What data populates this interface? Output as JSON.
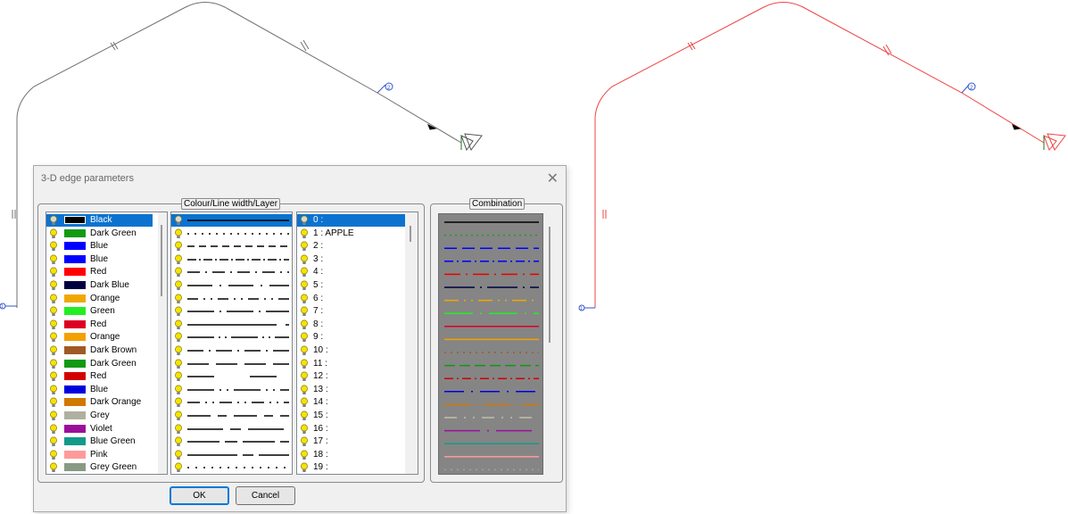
{
  "dialog": {
    "title": "3-D edge parameters",
    "group_colour_label": "Colour/Line width/Layer",
    "group_combination_label": "Combination",
    "ok_label": "OK",
    "cancel_label": "Cancel"
  },
  "colours": [
    {
      "name": "Black",
      "color": "#000000",
      "selected": true
    },
    {
      "name": "Dark Green",
      "color": "#129a12"
    },
    {
      "name": "Blue",
      "color": "#0000ff"
    },
    {
      "name": "Blue",
      "color": "#0000ff"
    },
    {
      "name": "Red",
      "color": "#ff0000"
    },
    {
      "name": "Dark Blue",
      "color": "#000040"
    },
    {
      "name": "Orange",
      "color": "#f0a800"
    },
    {
      "name": "Green",
      "color": "#22ee22"
    },
    {
      "name": "Red",
      "color": "#dd0022"
    },
    {
      "name": "Orange",
      "color": "#f4a000"
    },
    {
      "name": "Dark Brown",
      "color": "#a05a24"
    },
    {
      "name": "Dark Green",
      "color": "#119911"
    },
    {
      "name": "Red",
      "color": "#d40000"
    },
    {
      "name": "Blue",
      "color": "#0000dd"
    },
    {
      "name": "Dark Orange",
      "color": "#d07800"
    },
    {
      "name": "Grey",
      "color": "#b0b0a0"
    },
    {
      "name": "Violet",
      "color": "#9a0f9a"
    },
    {
      "name": "Blue Green",
      "color": "#129a88"
    },
    {
      "name": "Pink",
      "color": "#ff9a9a"
    },
    {
      "name": "Grey Green",
      "color": "#889a84"
    }
  ],
  "linestyles": [
    {
      "dash": "",
      "selected": true
    },
    {
      "dash": "2 6"
    },
    {
      "dash": "8 5"
    },
    {
      "dash": "10 3 2 3"
    },
    {
      "dash": "14 6 2 6"
    },
    {
      "dash": "28 8 2 8"
    },
    {
      "dash": "12 6 2 6 2 6"
    },
    {
      "dash": "30 6 2 6"
    },
    {
      "dash": "100 10"
    },
    {
      "dash": "30 5 2 5 2 5"
    },
    {
      "dash": "18 6 2 6"
    },
    {
      "dash": "24 8"
    },
    {
      "dash": "30 40"
    },
    {
      "dash": "30 6 2 6 2 6"
    },
    {
      "dash": "14 6 2 6 2 6"
    },
    {
      "dash": "26 8 10 8"
    },
    {
      "dash": "40 8 12 8"
    },
    {
      "dash": "36 6 14 6"
    },
    {
      "dash": "56 6 12 6"
    },
    {
      "dash": "2 7"
    }
  ],
  "layers": [
    {
      "label": "0 :",
      "selected": true
    },
    {
      "label": "1 : APPLE"
    },
    {
      "label": "2 :"
    },
    {
      "label": "3 :"
    },
    {
      "label": "4 :"
    },
    {
      "label": "5 :"
    },
    {
      "label": "6 :"
    },
    {
      "label": "7 :"
    },
    {
      "label": "8 :"
    },
    {
      "label": "9 :"
    },
    {
      "label": "10 :"
    },
    {
      "label": "11 :"
    },
    {
      "label": "12 :"
    },
    {
      "label": "13 :"
    },
    {
      "label": "14 :"
    },
    {
      "label": "15 :"
    },
    {
      "label": "16 :"
    },
    {
      "label": "17 :"
    },
    {
      "label": "18 :"
    },
    {
      "label": "19 :"
    }
  ],
  "combinations": [
    {
      "color": "#000000",
      "dash": ""
    },
    {
      "color": "#18a018",
      "dash": "2 4"
    },
    {
      "color": "#0000ff",
      "dash": "14 6"
    },
    {
      "color": "#0000ff",
      "dash": "10 4 2 4"
    },
    {
      "color": "#ee0000",
      "dash": "18 6 2 6"
    },
    {
      "color": "#000040",
      "dash": "34 6 2 6"
    },
    {
      "color": "#f0a800",
      "dash": "16 6 2 6 2 6"
    },
    {
      "color": "#22ee22",
      "dash": "32 8 2 8"
    },
    {
      "color": "#dd0022",
      "dash": ""
    },
    {
      "color": "#f4a000",
      "dash": ""
    },
    {
      "color": "#a05a24",
      "dash": "2 5"
    },
    {
      "color": "#119911",
      "dash": "12 5"
    },
    {
      "color": "#d40000",
      "dash": "10 4 2 4"
    },
    {
      "color": "#0000dd",
      "dash": "22 8 2 8"
    },
    {
      "color": "#d07800",
      "dash": "30 6 2 6"
    },
    {
      "color": "#c0c0a8",
      "dash": "14 8 2 8 2 8"
    },
    {
      "color": "#9a0f9a",
      "dash": "40 8 2 8"
    },
    {
      "color": "#129a88",
      "dash": ""
    },
    {
      "color": "#ff9a9a",
      "dash": ""
    },
    {
      "color": "#9aa698",
      "dash": "2 5"
    }
  ],
  "drawing": {
    "left_color": "#707070",
    "right_color": "#ee4444",
    "node_labels": [
      "1",
      "2"
    ]
  }
}
